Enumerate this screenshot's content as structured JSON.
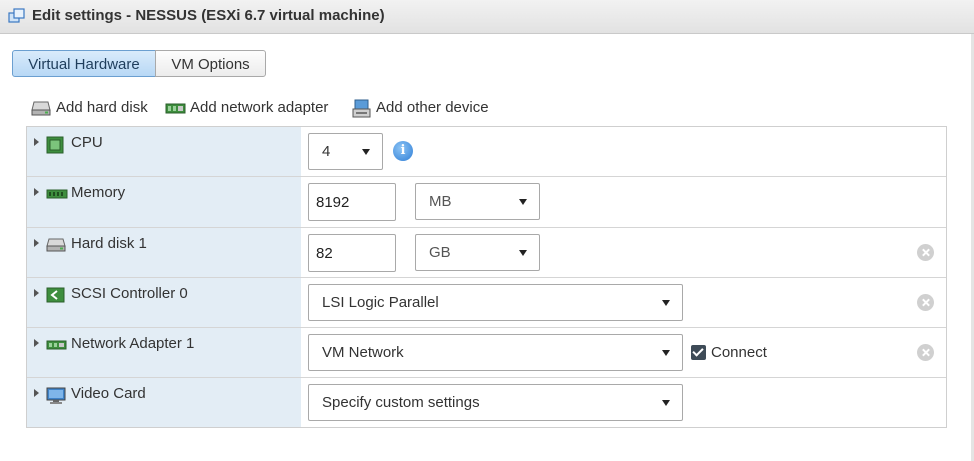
{
  "window": {
    "title": "Edit settings - NESSUS (ESXi 6.7 virtual machine)"
  },
  "tabs": [
    {
      "label": "Virtual Hardware",
      "active": true
    },
    {
      "label": "VM Options",
      "active": false
    }
  ],
  "toolbar": {
    "add_hard_disk": "Add hard disk",
    "add_network_adapter": "Add network adapter",
    "add_other_device": "Add other device"
  },
  "devices": {
    "cpu": {
      "label": "CPU",
      "icon": "cpu-icon",
      "value": "4"
    },
    "memory": {
      "label": "Memory",
      "icon": "memory-icon",
      "value": "8192",
      "unit": "MB"
    },
    "hard_disk": {
      "label": "Hard disk 1",
      "icon": "hard-disk-icon",
      "value": "82",
      "unit": "GB"
    },
    "scsi": {
      "label": "SCSI Controller 0",
      "icon": "scsi-controller-icon",
      "value": "LSI Logic Parallel"
    },
    "network": {
      "label": "Network Adapter 1",
      "icon": "network-adapter-icon",
      "value": "VM Network",
      "connect_label": "Connect",
      "connected": true
    },
    "video": {
      "label": "Video Card",
      "icon": "video-card-icon",
      "value": "Specify custom settings"
    }
  },
  "colors": {
    "accent": "#2f7ed6",
    "label_column": "#e3edf5",
    "active_tab": "#b8d8f5"
  }
}
